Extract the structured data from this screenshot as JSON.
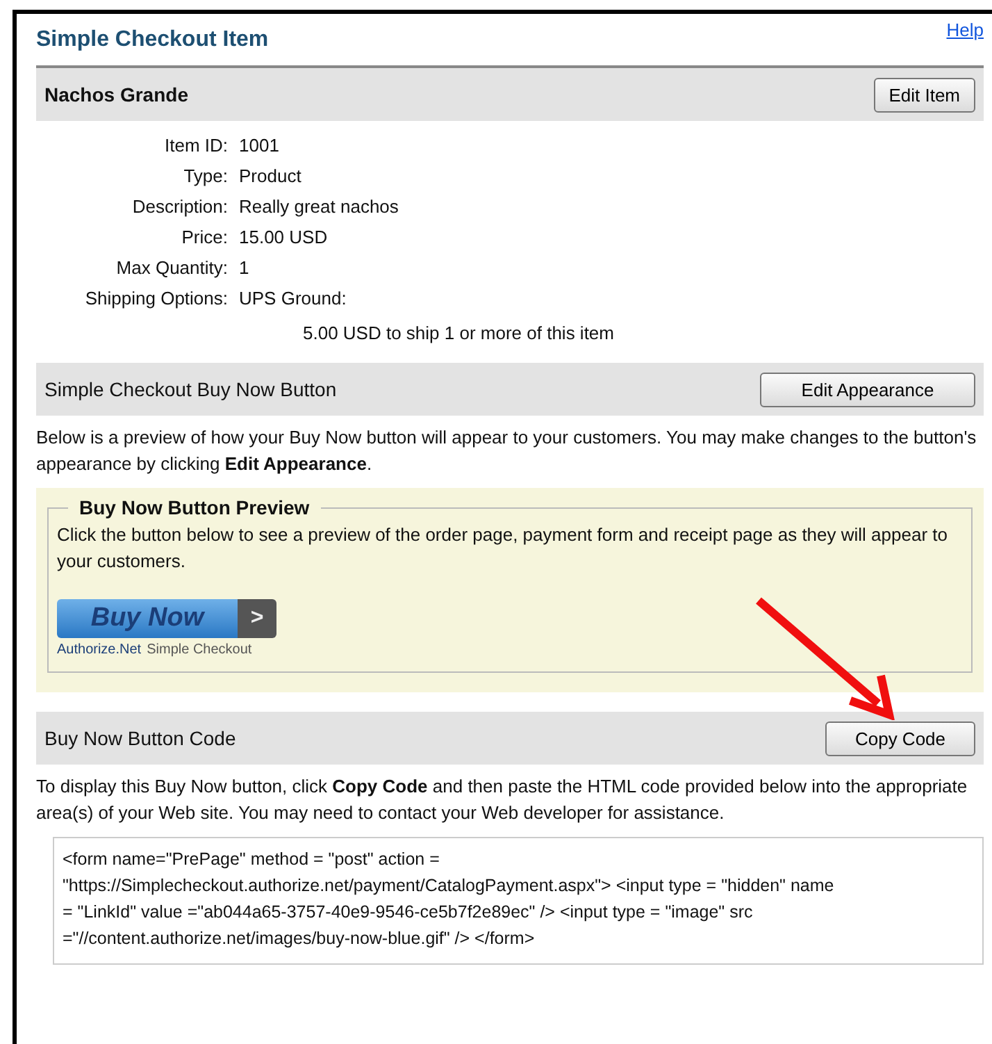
{
  "page": {
    "title": "Simple Checkout Item",
    "help_link": "Help"
  },
  "item_section": {
    "title": "Nachos Grande",
    "button": "Edit Item"
  },
  "item_details": [
    {
      "label": "Item ID:",
      "value": "1001"
    },
    {
      "label": "Type:",
      "value": "Product"
    },
    {
      "label": "Description:",
      "value": "Really great nachos"
    },
    {
      "label": "Price:",
      "value": "15.00 USD"
    },
    {
      "label": "Max Quantity:",
      "value": "1"
    },
    {
      "label": "Shipping Options:",
      "value": "UPS Ground:"
    }
  ],
  "shipping_note": "5.00 USD to ship 1 or more of this item",
  "button_section": {
    "title": "Simple Checkout Buy Now Button",
    "button": "Edit Appearance",
    "description": "Below is a preview of how your Buy Now button will appear to your customers. You may make changes to the button's appearance by clicking **Edit Appearance**."
  },
  "preview": {
    "legend": "Buy Now Button Preview",
    "text": "Click the button below to see a preview of the order page, payment form and receipt page as they will appear to your customers.",
    "buy_button": {
      "label": "Buy Now",
      "arrow": ">"
    },
    "brand": "Authorize.Net",
    "brand_caption": "Simple Checkout"
  },
  "code_section": {
    "title": "Buy Now Button Code",
    "button": "Copy Code",
    "description": "To display this Buy Now button, click **Copy Code** and then paste the HTML code provided below into the appropriate area(s) of your Web site. You may need to contact your Web developer for assistance.",
    "code_lines": [
      "<form name=\"PrePage\" method = \"post\" action =",
      "\"https://Simplecheckout.authorize.net/payment/CatalogPayment.aspx\"> <input type = \"hidden\" name",
      "= \"LinkId\" value =\"ab044a65-3757-40e9-9546-ce5b7f2e89ec\" /> <input type = \"image\" src",
      "=\"//content.authorize.net/images/buy-now-blue.gif\" /> </form>"
    ]
  }
}
